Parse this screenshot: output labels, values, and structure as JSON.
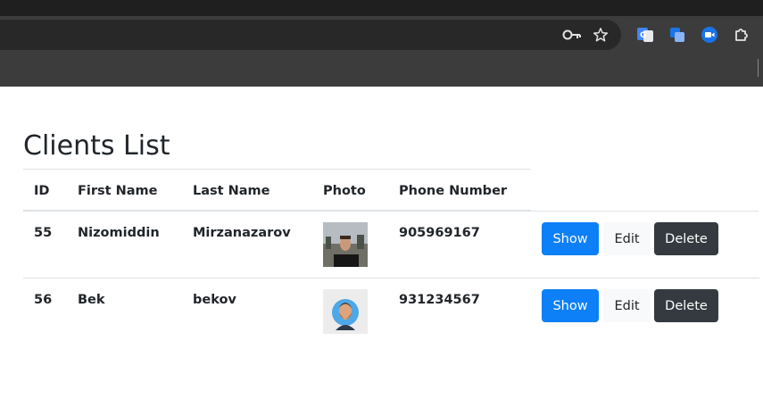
{
  "browser": {
    "icons": {
      "password": "key-icon",
      "bookmark": "star-icon",
      "extensions": [
        "google-translate-icon",
        "translator-icon",
        "video-camera-icon",
        "puzzle-extensions-icon"
      ]
    }
  },
  "page": {
    "title": "Clients List"
  },
  "table": {
    "headers": {
      "id": "ID",
      "first_name": "First Name",
      "last_name": "Last Name",
      "photo": "Photo",
      "phone": "Phone Number"
    },
    "rows": [
      {
        "id": "55",
        "first_name": "Nizomiddin",
        "last_name": "Mirzanazarov",
        "phone": "905969167",
        "photo": "person-photo"
      },
      {
        "id": "56",
        "first_name": "Bek",
        "last_name": "bekov",
        "phone": "931234567",
        "photo": "avatar-illustration"
      }
    ],
    "actions": {
      "show": "Show",
      "edit": "Edit",
      "delete": "Delete"
    }
  },
  "colors": {
    "primary": "#0d7ff7",
    "light": "#f8f9fa",
    "dark": "#343a40",
    "border": "#dee2e6"
  }
}
